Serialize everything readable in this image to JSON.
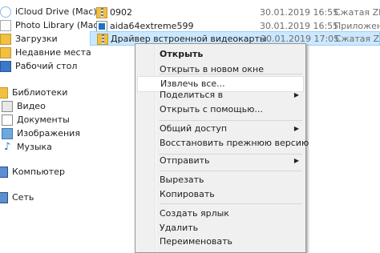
{
  "nav": {
    "items": [
      {
        "label": "iCloud Drive (Mac)",
        "icon": "icloud-drive-icon"
      },
      {
        "label": "Photo Library (Mac)",
        "icon": "photo-library-icon"
      },
      {
        "label": "Загрузки",
        "icon": "downloads-icon"
      },
      {
        "label": "Недавние места",
        "icon": "recent-places-icon"
      },
      {
        "label": "Рабочий стол",
        "icon": "desktop-icon"
      },
      {
        "label": "Библиотеки",
        "icon": "libraries-icon"
      },
      {
        "label": "Видео",
        "icon": "video-library-icon"
      },
      {
        "label": "Документы",
        "icon": "documents-library-icon"
      },
      {
        "label": "Изображения",
        "icon": "pictures-library-icon"
      },
      {
        "label": "Музыка",
        "icon": "music-library-icon"
      },
      {
        "label": "Компьютер",
        "icon": "computer-icon"
      },
      {
        "label": "Сеть",
        "icon": "network-icon"
      }
    ]
  },
  "files": [
    {
      "name": "0902",
      "date": "30.01.2019 16:55",
      "type": "Сжатая ZIP-...",
      "icon": "zip-folder-icon"
    },
    {
      "name": "aida64extreme599",
      "date": "30.01.2019 16:55",
      "type": "Приложение",
      "icon": "application-icon"
    },
    {
      "name": "Драйвер встроенной видеокарты",
      "date": "30.01.2019 17:05",
      "type": "Сжатая ZIP-...",
      "icon": "zip-folder-icon"
    }
  ],
  "menu": {
    "items": [
      {
        "label": "Открыть",
        "bold": true
      },
      {
        "label": "Открыть в новом окне"
      },
      {
        "label": "Извлечь все...",
        "highlighted": true
      },
      {
        "label": "Поделиться в",
        "submenu": true
      },
      {
        "label": "Открыть с помощью..."
      },
      {
        "label": "Общий доступ",
        "submenu": true
      },
      {
        "label": "Восстановить прежнюю версию"
      },
      {
        "label": "Отправить",
        "submenu": true
      },
      {
        "label": "Вырезать"
      },
      {
        "label": "Копировать"
      },
      {
        "label": "Создать ярлык"
      },
      {
        "label": "Удалить"
      },
      {
        "label": "Переименовать"
      }
    ]
  },
  "colors": {
    "selection": "#cce8ff",
    "menu_bg": "#f0f0f0",
    "accent": "#1a73c8"
  }
}
